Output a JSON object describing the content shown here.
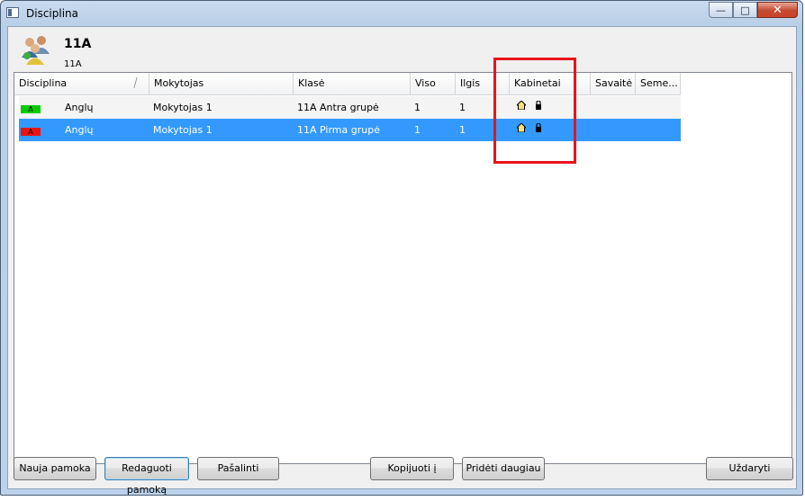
{
  "window": {
    "title": "Disciplina",
    "controls": {
      "minimize": "—",
      "maximize": "□",
      "close": "✕"
    }
  },
  "header": {
    "title": "11A",
    "subtitle": "11A",
    "icon": "users-group-icon"
  },
  "table": {
    "columns": [
      "Disciplina",
      "Mokytojas",
      "Klasė",
      "Viso",
      "Ilgis",
      "Kabinetai",
      "Savaitė",
      "Seme..."
    ],
    "rows": [
      {
        "tag": "A",
        "tag_color": "#00cc00",
        "disciplina": "Anglų",
        "mokytojas": "Mokytojas 1",
        "klase": "11A Antra grupė",
        "viso": "1",
        "ilgis": "1",
        "kabinetai_icons": [
          "home-icon",
          "lock-icon"
        ],
        "savaite": "",
        "semestras": ""
      },
      {
        "tag": "A",
        "tag_color": "#ee1111",
        "disciplina": "Anglų",
        "mokytojas": "Mokytojas 1",
        "klase": "11A Pirma grupė",
        "viso": "1",
        "ilgis": "1",
        "kabinetai_icons": [
          "home-icon",
          "lock-icon"
        ],
        "savaite": "",
        "semestras": "",
        "selected": true
      }
    ]
  },
  "buttons": {
    "new": "Nauja pamoka",
    "edit": "Redaguoti pamoką",
    "delete": "Pašalinti",
    "copy": "Kopijuoti į",
    "add_many": "Pridėti daugiau",
    "close": "Uždaryti"
  },
  "colors": {
    "selection": "#3399ff",
    "highlight_box": "#e8141c"
  }
}
